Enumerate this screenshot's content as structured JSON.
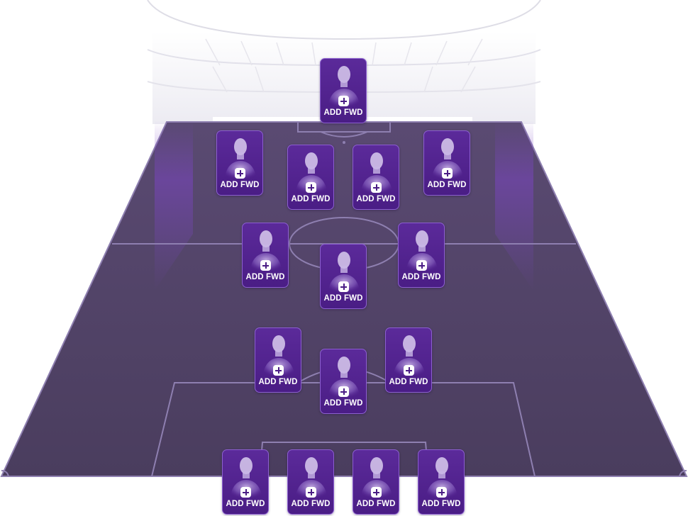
{
  "formation": {
    "slots": [
      {
        "label": "ADD FWD"
      },
      {
        "label": "ADD FWD"
      },
      {
        "label": "ADD FWD"
      },
      {
        "label": "ADD FWD"
      },
      {
        "label": "ADD FWD"
      },
      {
        "label": "ADD FWD"
      },
      {
        "label": "ADD FWD"
      },
      {
        "label": "ADD FWD"
      },
      {
        "label": "ADD FWD"
      },
      {
        "label": "ADD FWD"
      },
      {
        "label": "ADD FWD"
      },
      {
        "label": "ADD FWD"
      },
      {
        "label": "ADD FWD"
      },
      {
        "label": "ADD FWD"
      },
      {
        "label": "ADD FWD"
      }
    ]
  },
  "colors": {
    "pitch": "#4e3f63",
    "pitch_lines": "#8e7fb0",
    "card": "#4a1d85",
    "card_border": "#8c5fd0",
    "spotlight": "#7a45c0"
  },
  "icons": {
    "add": "plus-square-icon",
    "player": "player-silhouette-icon"
  }
}
